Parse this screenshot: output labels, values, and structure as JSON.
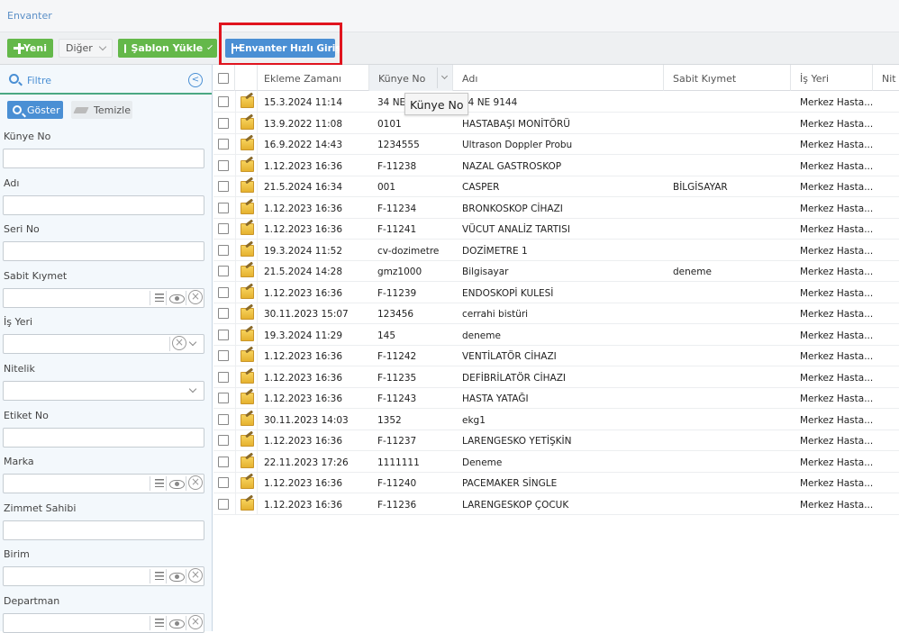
{
  "breadcrumb": "Envanter",
  "toolbar": {
    "new_label": "Yeni",
    "other_label": "Diğer",
    "template_label": "Şablon Yükle",
    "quick_entry_label": "Envanter Hızlı Giriş"
  },
  "filter": {
    "title": "Filtre",
    "show_label": "Göster",
    "clear_label": "Temizle",
    "fields": [
      {
        "label": "Künye No",
        "type": "text",
        "value": ""
      },
      {
        "label": "Adı",
        "type": "text",
        "value": ""
      },
      {
        "label": "Seri No",
        "type": "text",
        "value": ""
      },
      {
        "label": "Sabit Kıymet",
        "type": "lookup",
        "value": ""
      },
      {
        "label": "İş Yeri",
        "type": "select-clear",
        "value": ""
      },
      {
        "label": "Nitelik",
        "type": "select",
        "value": ""
      },
      {
        "label": "Etiket No",
        "type": "text",
        "value": ""
      },
      {
        "label": "Marka",
        "type": "lookup",
        "value": ""
      },
      {
        "label": "Zimmet Sahibi",
        "type": "text",
        "value": ""
      },
      {
        "label": "Birim",
        "type": "lookup",
        "value": ""
      },
      {
        "label": "Departman",
        "type": "lookup",
        "value": ""
      }
    ]
  },
  "grid": {
    "columns": [
      "Ekleme Zamanı",
      "Künye No",
      "Adı",
      "Sabit Kıymet",
      "İş Yeri",
      "Nit"
    ],
    "tooltip": "Künye No",
    "rows": [
      {
        "date": "15.3.2024 11:14",
        "kunye": "34 NE",
        "name": "34 NE 9144",
        "fixed": "",
        "place": "Merkez Hasta..."
      },
      {
        "date": "13.9.2022 11:08",
        "kunye": "0101",
        "name": "HASTABAŞI MONİTÖRÜ",
        "fixed": "",
        "place": "Merkez Hasta..."
      },
      {
        "date": "16.9.2022 14:43",
        "kunye": "1234555",
        "name": "Ultrason Doppler Probu",
        "fixed": "",
        "place": "Merkez Hasta..."
      },
      {
        "date": "1.12.2023 16:36",
        "kunye": "F-11238",
        "name": "NAZAL GASTROSKOP",
        "fixed": "",
        "place": "Merkez Hasta..."
      },
      {
        "date": "21.5.2024 16:34",
        "kunye": "001",
        "name": "CASPER",
        "fixed": "BİLGİSAYAR",
        "place": "Merkez Hasta..."
      },
      {
        "date": "1.12.2023 16:36",
        "kunye": "F-11234",
        "name": "BRONKOSKOP CİHAZI",
        "fixed": "",
        "place": "Merkez Hasta..."
      },
      {
        "date": "1.12.2023 16:36",
        "kunye": "F-11241",
        "name": "VÜCUT ANALİZ TARTISI",
        "fixed": "",
        "place": "Merkez Hasta..."
      },
      {
        "date": "19.3.2024 11:52",
        "kunye": "cv-dozimetre",
        "name": "DOZİMETRE 1",
        "fixed": "",
        "place": "Merkez Hasta..."
      },
      {
        "date": "21.5.2024 14:28",
        "kunye": "gmz1000",
        "name": "Bilgisayar",
        "fixed": "deneme",
        "place": "Merkez Hasta..."
      },
      {
        "date": "1.12.2023 16:36",
        "kunye": "F-11239",
        "name": "ENDOSKOPİ KULESİ",
        "fixed": "",
        "place": "Merkez Hasta..."
      },
      {
        "date": "30.11.2023 15:07",
        "kunye": "123456",
        "name": "cerrahi bistüri",
        "fixed": "",
        "place": "Merkez Hasta..."
      },
      {
        "date": "19.3.2024 11:29",
        "kunye": "145",
        "name": "deneme",
        "fixed": "",
        "place": "Merkez Hasta..."
      },
      {
        "date": "1.12.2023 16:36",
        "kunye": "F-11242",
        "name": "VENTİLATÖR CİHAZI",
        "fixed": "",
        "place": "Merkez Hasta..."
      },
      {
        "date": "1.12.2023 16:36",
        "kunye": "F-11235",
        "name": "DEFİBRİLATÖR CİHAZI",
        "fixed": "",
        "place": "Merkez Hasta..."
      },
      {
        "date": "1.12.2023 16:36",
        "kunye": "F-11243",
        "name": "HASTA YATAĞI",
        "fixed": "",
        "place": "Merkez Hasta..."
      },
      {
        "date": "30.11.2023 14:03",
        "kunye": "1352",
        "name": "ekg1",
        "fixed": "",
        "place": "Merkez Hasta..."
      },
      {
        "date": "1.12.2023 16:36",
        "kunye": "F-11237",
        "name": "LARENGESKO YETİŞKİN",
        "fixed": "",
        "place": "Merkez Hasta..."
      },
      {
        "date": "22.11.2023 17:26",
        "kunye": "1111111",
        "name": "Deneme",
        "fixed": "",
        "place": "Merkez Hasta..."
      },
      {
        "date": "1.12.2023 16:36",
        "kunye": "F-11240",
        "name": "PACEMAKER SİNGLE",
        "fixed": "",
        "place": "Merkez Hasta..."
      },
      {
        "date": "1.12.2023 16:36",
        "kunye": "F-11236",
        "name": "LARENGESKOP ÇOCUK",
        "fixed": "",
        "place": "Merkez Hasta..."
      }
    ]
  }
}
